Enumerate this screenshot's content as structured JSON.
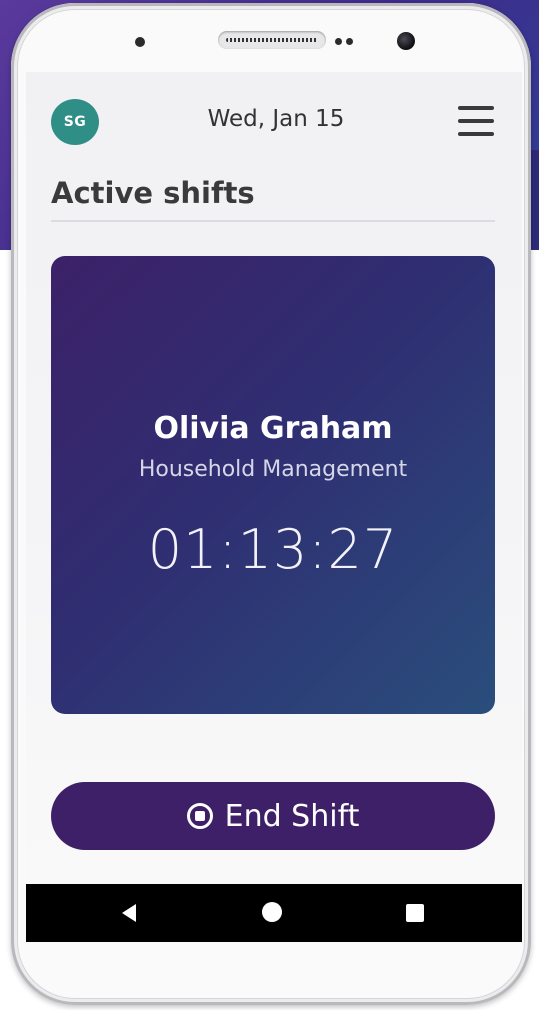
{
  "header": {
    "avatar_initials": "SG",
    "date": "Wed, Jan 15",
    "menu_icon": "hamburger-menu-icon"
  },
  "main": {
    "title": "Active shifts",
    "shift": {
      "name": "Olivia Graham",
      "department": "Household Management",
      "timer": "01:13:27"
    },
    "end_button": {
      "label": "End Shift",
      "icon": "stop-circle-icon"
    }
  },
  "navbar": {
    "back_icon": "back-triangle-icon",
    "home_icon": "home-circle-icon",
    "recents_icon": "recents-square-icon"
  },
  "colors": {
    "avatar": "#2f8e85",
    "card_gradient_start": "#3c2168",
    "card_gradient_end": "#2a4e7c",
    "button": "#3e2068"
  }
}
